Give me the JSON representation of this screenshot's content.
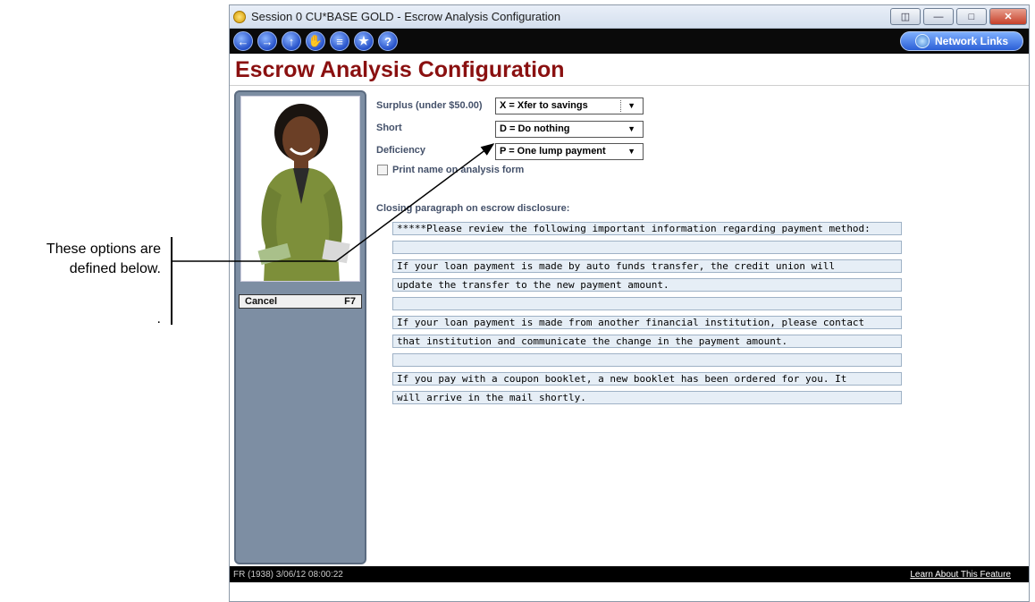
{
  "annotation": {
    "line1": "These options are",
    "line2": "defined below.",
    "line3": "."
  },
  "window": {
    "title": "Session 0 CU*BASE GOLD - Escrow Analysis Configuration"
  },
  "navbar": {
    "buttons": [
      "back",
      "forward",
      "up",
      "stop",
      "list",
      "favorite",
      "help"
    ],
    "network_links": "Network Links"
  },
  "page": {
    "title": "Escrow Analysis Configuration"
  },
  "sidebar": {
    "cancel_label": "Cancel",
    "cancel_key": "F7"
  },
  "form": {
    "surplus_label": "Surplus (under $50.00)",
    "surplus_value": "X = Xfer to savings",
    "short_label": "Short",
    "short_value": "D = Do nothing",
    "deficiency_label": "Deficiency",
    "deficiency_value": "P = One lump payment",
    "print_name_label": "Print name on analysis form",
    "closing_label": "Closing paragraph on escrow disclosure:",
    "closing_lines": [
      "*****Please review the following important information regarding payment method:",
      "",
      "If your loan payment is made by auto funds transfer, the credit union will",
      "update the transfer to the new payment amount.",
      "",
      "If your loan payment is made from another financial institution, please contact",
      "that institution and communicate the change in the payment amount.",
      "",
      "If you pay with a coupon booklet, a new booklet has been ordered for you. It",
      "will arrive in the mail shortly."
    ]
  },
  "footer": {
    "status": "FR (1938) 3/06/12 08:00:22",
    "learn_link": "Learn About This Feature"
  },
  "colors": {
    "title_red": "#8a1010",
    "sidebar": "#7d8ea3",
    "text_field": "#e6eef6"
  }
}
